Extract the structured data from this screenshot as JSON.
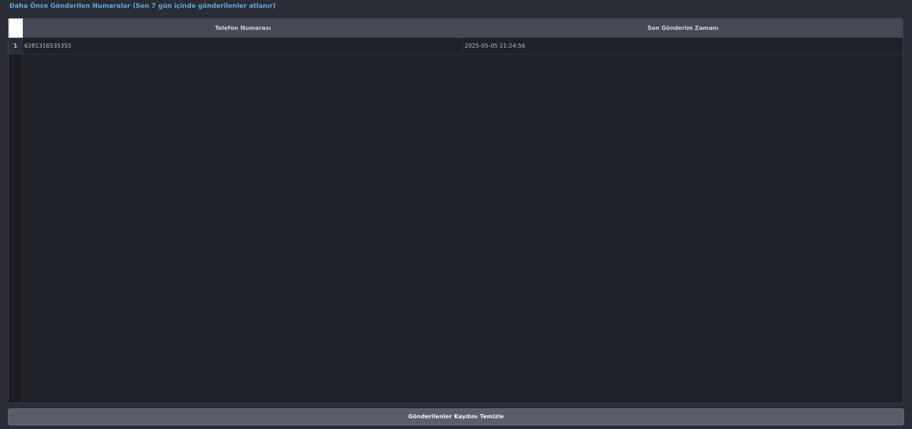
{
  "group": {
    "title": "Daha Önce Gönderilen Numaralar (Son 7 gün içinde gönderilenler atlanır)"
  },
  "table": {
    "columns": [
      "Telefon Numarası",
      "Son Gönderim Zamanı"
    ],
    "rows": [
      {
        "index": "1",
        "phone": "6281316535355",
        "last_sent": "2025-05-05 21:24:56"
      }
    ]
  },
  "actions": {
    "clear_label": "Gönderilenler Kaydını Temizle"
  },
  "colors": {
    "accent": "#5aa9e6",
    "background": "#2a2d35",
    "table_bg": "#20222a",
    "header_bg": "#454955",
    "button_bg": "#595e6b"
  }
}
